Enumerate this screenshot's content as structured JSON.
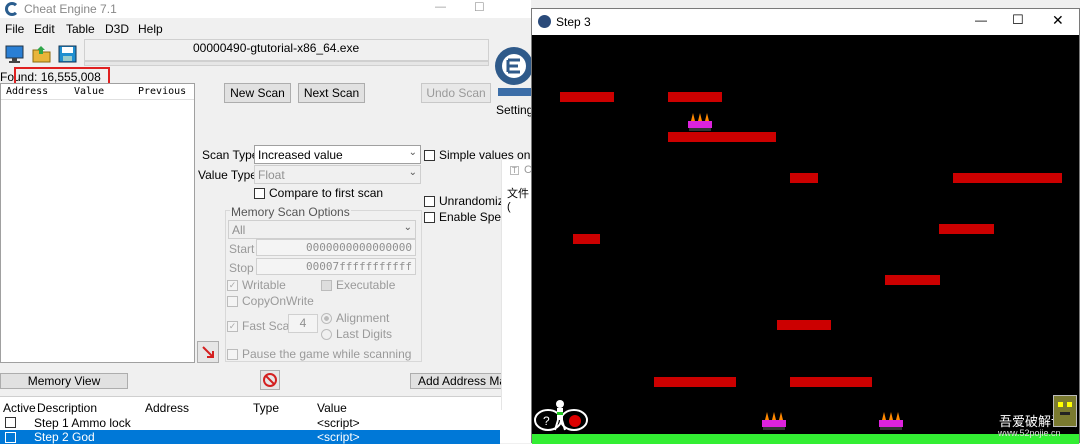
{
  "ce": {
    "title": "Cheat Engine 7.1",
    "menu": [
      "File",
      "Edit",
      "Table",
      "D3D",
      "Help"
    ],
    "process": "00000490-gtutorial-x86_64.exe",
    "found": "Found: 16,555,008",
    "columns": [
      "Address",
      "Value",
      "Previous"
    ],
    "buttons": {
      "new_scan": "New Scan",
      "next_scan": "Next Scan",
      "undo_scan": "Undo Scan",
      "settings": "Settings",
      "memory_view": "Memory View",
      "add_address": "Add Address Ma"
    },
    "scan_type_label": "Scan Type",
    "scan_type_value": "Increased value",
    "value_type_label": "Value Type",
    "value_type_value": "Float",
    "compare_first": "Compare to first scan",
    "simple_values": "Simple values only",
    "unrandomizer": "Unrandomize",
    "enable_speedhack": "Enable Speed",
    "memory_options_title": "Memory Scan Options",
    "region_value": "All",
    "start_label": "Start",
    "start_value": "0000000000000000",
    "stop_label": "Stop",
    "stop_value": "00007fffffffffff",
    "writable": "Writable",
    "executable": "Executable",
    "copy_on_write": "CopyOnWrite",
    "fast_scan": "Fast Scan",
    "fast_scan_value": "4",
    "alignment": "Alignment",
    "last_digits": "Last Digits",
    "pause_game": "Pause the game while scanning",
    "table_headers": [
      "Active",
      "Description",
      "Address",
      "Type",
      "Value"
    ],
    "table_rows": [
      {
        "description": "Step 1 Ammo lock",
        "value": "<script>"
      },
      {
        "description": "Step 2 God",
        "value": "<script>"
      }
    ],
    "ghost_window_text": "文件(",
    "ghost_window_title": "C"
  },
  "game": {
    "title": "Step 3",
    "watermark_cn": "吾爱破解论坛",
    "watermark_url": "www.52pojie.cn"
  },
  "colors": {
    "platform": "#cc0000",
    "ground": "#33ee33",
    "enemy": "#dd22dd",
    "selection": "#0078d7"
  },
  "icons": [
    "ce-logo-icon",
    "monitor-icon",
    "open-icon",
    "save-icon",
    "arrow-icon",
    "stop-icon",
    "minimize-icon",
    "maximize-icon",
    "close-icon"
  ]
}
